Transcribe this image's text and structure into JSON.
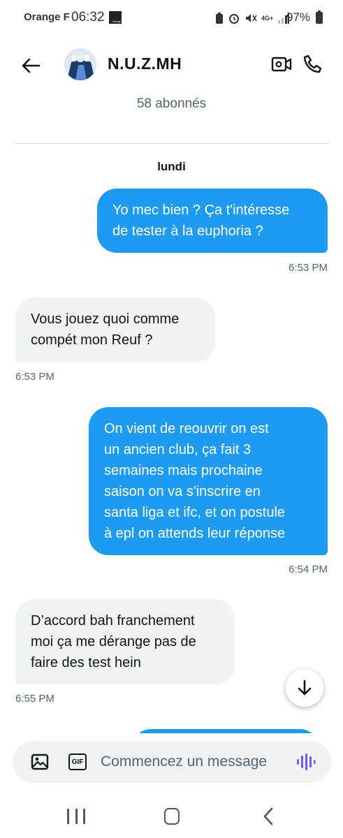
{
  "status_bar": {
    "carrier": "Orange F",
    "time": "06:32",
    "carrier_logo_text": "orange",
    "network": "4G+",
    "battery": "97%"
  },
  "header": {
    "contact_name": "N.U.Z.MH",
    "followers": "58 abonnés",
    "icons": [
      "back-arrow-icon",
      "video-camera-icon",
      "phone-icon"
    ]
  },
  "conversation": {
    "day": "lundi",
    "messages": [
      {
        "direction": "out",
        "lines": [
          "Yo mec bien ? Ça t'intéresse",
          "de tester à la euphoria ?"
        ],
        "time": "6:53 PM"
      },
      {
        "direction": "in",
        "lines": [
          "Vous jouez quoi comme",
          "compét mon Reuf ?"
        ],
        "time": "6:53 PM"
      },
      {
        "direction": "out",
        "lines": [
          "On vient de reouvrir on est",
          "un ancien club, ça fait 3",
          "semaines mais prochaine",
          "saison on va s'inscrire en",
          "santa liga et ifc, et on postule",
          "à epl on attends leur réponse"
        ],
        "time": "6:54 PM"
      },
      {
        "direction": "in",
        "lines": [
          "D’accord bah franchement",
          "moi ça me dérange pas de",
          "faire des test hein"
        ],
        "time": "6:55 PM"
      }
    ]
  },
  "composer": {
    "placeholder": "Commencez un message",
    "gif_label": "GIF"
  },
  "colors": {
    "accent": "#1d9bf0",
    "incoming_bubble": "#eff3f4",
    "voice_icon": "#7856ff",
    "secondary_text": "#536471"
  }
}
